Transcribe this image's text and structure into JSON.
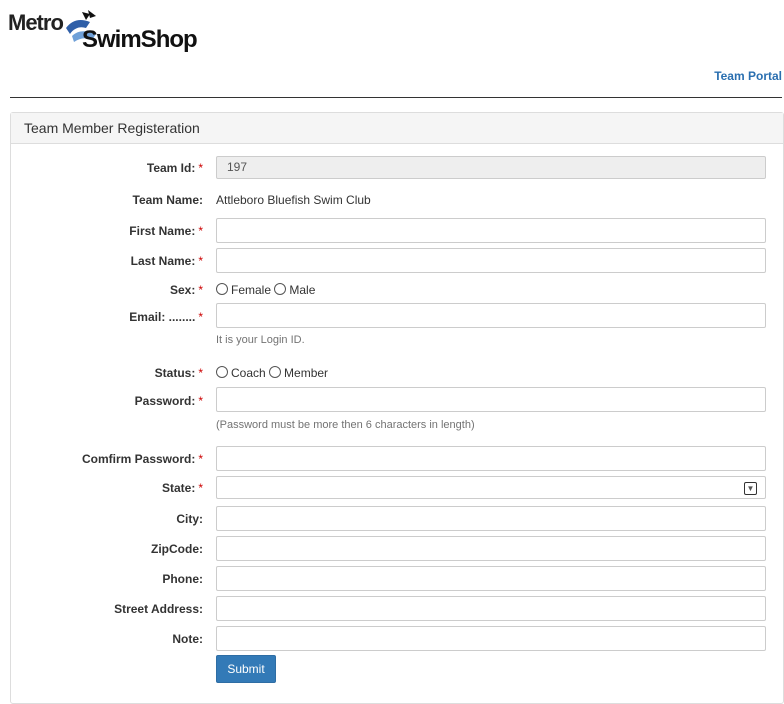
{
  "logo": {
    "brand_top": "Metro",
    "brand_bottom": "SwimShop"
  },
  "nav": {
    "team_portal": "Team Portal"
  },
  "panel": {
    "title": "Team Member Registeration"
  },
  "form": {
    "required_mark": "*",
    "team_id": {
      "label": "Team Id:",
      "value": "197"
    },
    "team_name": {
      "label": "Team Name:",
      "value": "Attleboro Bluefish Swim Club"
    },
    "first_name": {
      "label": "First Name:",
      "value": ""
    },
    "last_name": {
      "label": "Last Name:",
      "value": ""
    },
    "sex": {
      "label": "Sex:",
      "options": [
        "Female",
        "Male"
      ]
    },
    "email": {
      "label": "Email: ........",
      "value": "",
      "help": "It is your Login ID."
    },
    "status": {
      "label": "Status:",
      "options": [
        "Coach",
        "Member"
      ]
    },
    "password": {
      "label": "Password:",
      "value": "",
      "help": "(Password must be more then 6 characters in length)"
    },
    "confirm_password": {
      "label": "Comfirm Password:",
      "value": ""
    },
    "state": {
      "label": "State:",
      "value": ""
    },
    "city": {
      "label": "City:",
      "value": ""
    },
    "zipcode": {
      "label": "ZipCode:",
      "value": ""
    },
    "phone": {
      "label": "Phone:",
      "value": ""
    },
    "street_address": {
      "label": "Street Address:",
      "value": ""
    },
    "note": {
      "label": "Note:",
      "value": ""
    },
    "submit_label": "Submit"
  }
}
